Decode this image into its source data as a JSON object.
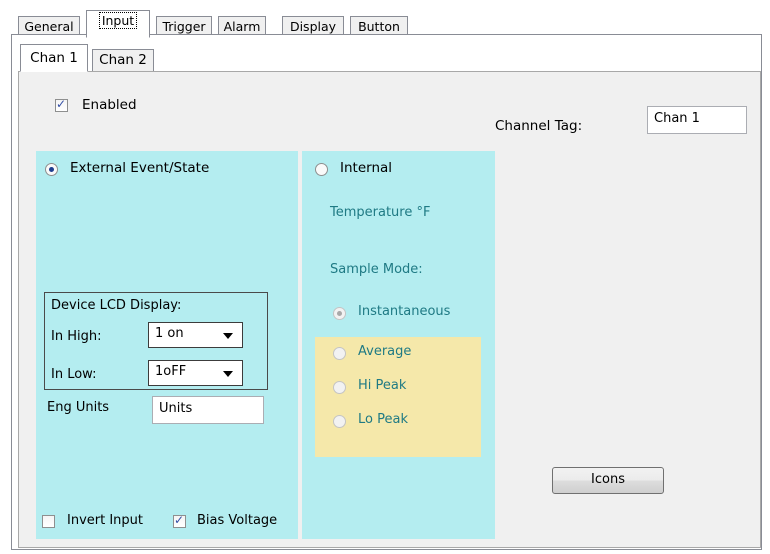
{
  "top_tabs": [
    "General",
    "Input",
    "Trigger",
    "Alarm",
    "Display",
    "Button"
  ],
  "channel_tabs": [
    "Chan 1",
    "Chan 2"
  ],
  "enabled": {
    "label": "Enabled",
    "checked": true
  },
  "channel_tag": {
    "label": "Channel Tag:",
    "value": "Chan 1"
  },
  "external": {
    "label": "External Event/State",
    "selected": true,
    "lcd_group_title": "Device LCD Display:",
    "in_high_label": "In High:",
    "in_high_value": "1 on",
    "in_low_label": "In Low:",
    "in_low_value": "1oFF",
    "eng_units_label": "Eng Units",
    "eng_units_value": "Units",
    "invert_input_label": "Invert Input",
    "invert_input_checked": false,
    "bias_voltage_label": "Bias Voltage",
    "bias_voltage_checked": true
  },
  "internal": {
    "label": "Internal",
    "selected": false,
    "temperature_label": "Temperature °F",
    "sample_mode_label": "Sample Mode:",
    "options": [
      "Instantaneous",
      "Average",
      "Hi Peak",
      "Lo Peak"
    ],
    "selected_option": "Instantaneous"
  },
  "icons_button": "Icons",
  "colors": {
    "cyan_panel": "#b4edf0",
    "yellow_panel": "#f5e8aa",
    "dialog_bg": "#f0f0f0",
    "teal_text": "#1f7a84"
  },
  "icons": {
    "checkmark": "checkmark-icon",
    "radio_dot": "radio-dot-icon",
    "dropdown": "chevron-down-icon"
  }
}
